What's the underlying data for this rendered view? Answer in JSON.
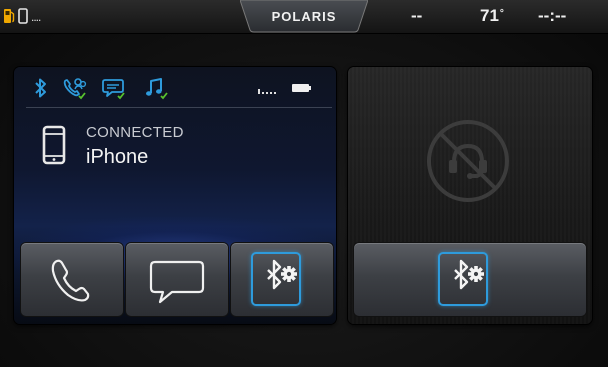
{
  "status_bar": {
    "left_indicator": "....",
    "brand": "POLARIS",
    "left_value": "--",
    "temperature": "71",
    "temperature_unit": "°",
    "time": "--:--"
  },
  "phone_panel": {
    "connection_status": "CONNECTED",
    "device_name": "iPhone",
    "feature_icons": [
      "bluetooth-icon",
      "phone-contacts-icon",
      "messages-icon",
      "music-icon"
    ],
    "signal_indicator": ".....",
    "battery_icon": "battery-icon"
  },
  "buttons": {
    "call": "phone-handset-icon",
    "messages": "chat-bubble-icon",
    "bluetooth_settings": "bluetooth-settings-icon"
  },
  "second_device_panel": {
    "icon": "no-device-icon",
    "button": "bluetooth-settings-icon"
  },
  "colors": {
    "accent_blue": "#2e9bdc",
    "check_green": "#58c22e",
    "fuel_yellow": "#f0a800"
  }
}
